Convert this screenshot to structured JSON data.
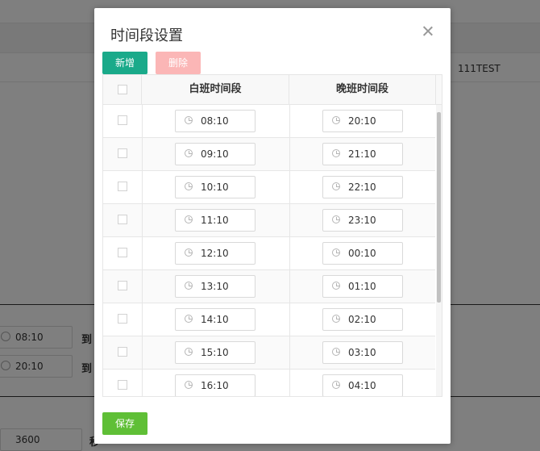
{
  "background": {
    "row_text": "111TEST",
    "time_field_1": "08:10",
    "time_field_2": "20:10",
    "to_label": "到",
    "seconds_field": "3600",
    "seconds_label": "秒"
  },
  "modal": {
    "title": "时间段设置",
    "add_label": "新增",
    "delete_label": "删除",
    "save_label": "保存",
    "columns": [
      "白班时间段",
      "晚班时间段"
    ],
    "rows": [
      {
        "day": "08:10",
        "night": "20:10"
      },
      {
        "day": "09:10",
        "night": "21:10"
      },
      {
        "day": "10:10",
        "night": "22:10"
      },
      {
        "day": "11:10",
        "night": "23:10"
      },
      {
        "day": "12:10",
        "night": "00:10"
      },
      {
        "day": "13:10",
        "night": "01:10"
      },
      {
        "day": "14:10",
        "night": "02:10"
      },
      {
        "day": "15:10",
        "night": "03:10"
      },
      {
        "day": "16:10",
        "night": "04:10"
      }
    ]
  },
  "colors": {
    "add_button": "#1aaa8a",
    "delete_button": "#fbb6b6",
    "save_button": "#5fbf36",
    "overlay": "rgba(0,0,0,0.5)"
  }
}
